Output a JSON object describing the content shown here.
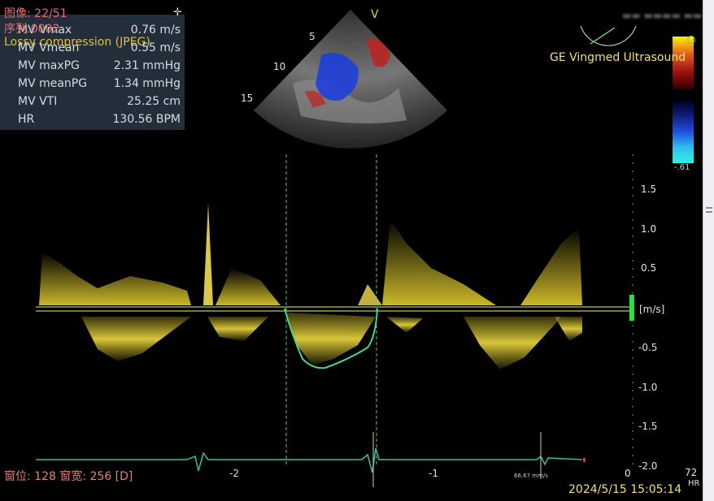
{
  "overlay": {
    "image_index": "图像: 22/51",
    "series": "序列:0002",
    "compression": "Lossy compression (JPEG)",
    "plus_icon": "plus-icon"
  },
  "measurements": [
    {
      "label": "MV Vmax",
      "value": "0.76 m/s"
    },
    {
      "label": "MV Vmean",
      "value": "0.55 m/s"
    },
    {
      "label": "MV maxPG",
      "value": "2.31 mmHg"
    },
    {
      "label": "MV meanPG",
      "value": "1.34 mmHg"
    },
    {
      "label": "MV VTI",
      "value": "25.25 cm"
    },
    {
      "label": "HR",
      "value": "130.56 BPM"
    }
  ],
  "header": {
    "vendor": "GE Vingmed Ultrasound",
    "sector_marker": "V",
    "depth_marks": [
      "5",
      "10",
      "15"
    ],
    "color_scale_bottom": "-.61"
  },
  "doppler": {
    "unit": "[m/s]",
    "velocity_ticks": [
      "1.5",
      "1.0",
      "0.5",
      "-0.5",
      "-1.0",
      "-1.5",
      "-2.0"
    ],
    "time_ticks": [
      "-2",
      "-1",
      "0"
    ],
    "ecg_rate_label": "66.67 mm/s",
    "hr_value": "72",
    "hr_unit": "HR"
  },
  "footer": {
    "window_info": "窗位: 128 窗宽: 256 [D]",
    "datetime": "2024/5/15 15:05:14"
  },
  "colors": {
    "spectral": "#e2cc2e",
    "envelope": "#40d890",
    "ecg": "#30c0a8",
    "cursor": "#5fd06a",
    "baseline": "#b8c850"
  }
}
